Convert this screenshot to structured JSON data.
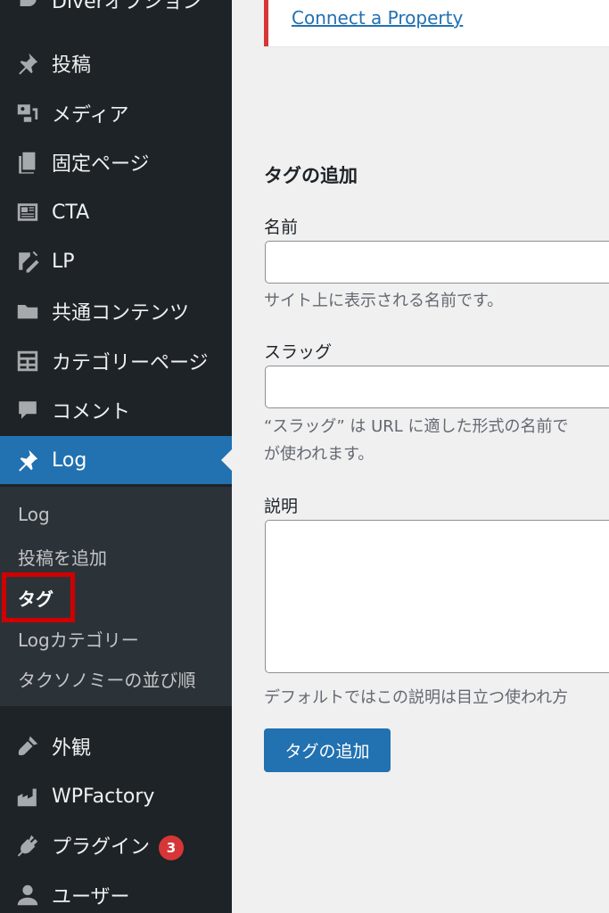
{
  "sidebar": {
    "partial_top": "Diverオプション",
    "items": [
      {
        "label": "投稿",
        "icon": "pin-icon"
      },
      {
        "label": "メディア",
        "icon": "media-icon"
      },
      {
        "label": "固定ページ",
        "icon": "page-icon"
      },
      {
        "label": "CTA",
        "icon": "cta-icon"
      },
      {
        "label": "LP",
        "icon": "edit-page-icon"
      },
      {
        "label": "共通コンテンツ",
        "icon": "folder-icon"
      },
      {
        "label": "カテゴリーページ",
        "icon": "grid-icon"
      },
      {
        "label": "コメント",
        "icon": "comment-icon"
      },
      {
        "label": "Log",
        "icon": "pin-icon",
        "active": true
      },
      {
        "label": "外観",
        "icon": "brush-icon"
      },
      {
        "label": "WPFactory",
        "icon": "factory-icon"
      },
      {
        "label": "プラグイン",
        "icon": "plugin-icon",
        "badge": "3"
      },
      {
        "label": "ユーザー",
        "icon": "user-icon"
      }
    ],
    "submenu": [
      {
        "label": "Log"
      },
      {
        "label": "投稿を追加"
      },
      {
        "label": "タグ",
        "current": true
      },
      {
        "label": "Logカテゴリー"
      },
      {
        "label": "タクソノミーの並び順"
      }
    ]
  },
  "notice": {
    "link": "Connect a Property"
  },
  "form": {
    "heading": "タグの追加",
    "name_label": "名前",
    "name_value": "",
    "name_help": "サイト上に表示される名前です。",
    "slug_label": "スラッグ",
    "slug_value": "",
    "slug_help_1": "“スラッグ” は URL に適した形式の名前で",
    "slug_help_2": "が使われます。",
    "desc_label": "説明",
    "desc_value": "",
    "desc_help": "デフォルトではこの説明は目立つ使われ方",
    "submit": "タグの追加"
  },
  "colors": {
    "sidebar_bg": "#1d2327",
    "submenu_bg": "#2c3338",
    "accent": "#2271b1",
    "highlight": "#d00000",
    "badge": "#d63638"
  }
}
